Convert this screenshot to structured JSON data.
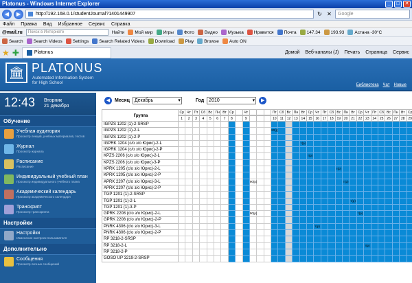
{
  "window": {
    "title": "Platonus - Windows Internet Explorer",
    "minimize": "_",
    "maximize": "□",
    "close": "✕"
  },
  "address": {
    "url": "http://192.168.0.1/studentJournal?1401449907",
    "search_placeholder": "Google",
    "back": "◀",
    "forward": "▶",
    "refresh": "↻",
    "stop": "✕"
  },
  "menu": [
    "Файл",
    "Правка",
    "Вид",
    "Избранное",
    "Сервис",
    "Справка"
  ],
  "toolbar": {
    "logo": "@mail.ru",
    "search_placeholder": "Поиск в Интернете",
    "find": "Найти",
    "items": [
      "Мой мир",
      "Игры",
      "Фото",
      "Видео",
      "Музыка",
      "Нравится",
      "Почта",
      "147.34",
      "193.93",
      "Астана -30°C"
    ]
  },
  "toolbar2": {
    "items": [
      "Search",
      "Search Videos",
      "Settings",
      "Search Related Videos",
      "Download",
      "Play",
      "Browse",
      "Auto ON"
    ]
  },
  "tabs": {
    "active": "Platonus",
    "tools": [
      "Домой",
      "Веб-каналы (J)",
      "Печать",
      "Страница",
      "Сервис"
    ]
  },
  "header": {
    "logo_glyph": "🏛",
    "brand": "PLATONUS",
    "sub1": "Automated Information System",
    "sub2": "for High School",
    "links": [
      "Библиотека",
      "Чат",
      "Новые"
    ]
  },
  "clock": {
    "time": "12:43",
    "day": "Вторник",
    "date": "21 декабря"
  },
  "sidebar": {
    "sections": [
      {
        "title": "Обучение",
        "items": [
          {
            "label": "Учебная аудитория",
            "sub": "Просмотр лекций, учебных материалов, тестов",
            "color": "#e8a040"
          },
          {
            "label": "Журнал",
            "sub": "Просмотр журнала",
            "color": "#6fb6e8"
          },
          {
            "label": "Расписание",
            "sub": "Расписание",
            "color": "#d8c060"
          },
          {
            "label": "Индивидуальный учебный план",
            "sub": "Просмотр индивидуального учебного плана",
            "color": "#80b860"
          },
          {
            "label": "Академический календарь",
            "sub": "Просмотр академического календаря",
            "color": "#c07060"
          },
          {
            "label": "Транскрипт",
            "sub": "Просмотр транскрипта",
            "color": "#a0a0d8"
          }
        ]
      },
      {
        "title": "Настройки",
        "items": [
          {
            "label": "Настройки",
            "sub": "Изменение настроек пользователя",
            "color": "#90a8c8"
          }
        ]
      },
      {
        "title": "Дополнительно",
        "items": [
          {
            "label": "Сообщения",
            "sub": "Просмотр личных сообщений",
            "color": "#e8c040"
          }
        ]
      }
    ]
  },
  "controls": {
    "prev": "◀",
    "next": "▶",
    "month_label": "Месяц",
    "month_value": "Декабрь",
    "year_label": "Год",
    "year_value": "2010"
  },
  "grid": {
    "group_header": "Группа",
    "weekday_row": [
      "Ср",
      "Чт",
      "Пт",
      "Сб",
      "Вс",
      "Пн",
      "Вт",
      "Ср",
      "",
      "Чт",
      "",
      "",
      "",
      "Пт",
      "Сб",
      "Вс",
      "Пн",
      "Вт",
      "Ср",
      "Чт",
      "Пт",
      "Сб",
      "Вс",
      "Пн",
      "Вт",
      "Ср",
      "Чт",
      "Пт",
      "Сб",
      "Вс",
      "Пн",
      "Вт",
      "Ср",
      "Чт",
      "Пт",
      "Сб"
    ],
    "day_row": [
      "1",
      "2",
      "3",
      "4",
      "5",
      "6",
      "7",
      "8",
      "",
      "9",
      "",
      "",
      "",
      "10",
      "11",
      "12",
      "13",
      "14",
      "15",
      "16",
      "17",
      "18",
      "19",
      "20",
      "21",
      "22",
      "23",
      "24",
      "25",
      "26",
      "27",
      "28",
      "29",
      "30",
      "31",
      ""
    ],
    "rows": [
      {
        "name": "IGPZS 1202 (1)-2-SRSP",
        "marks": {}
      },
      {
        "name": "IGPZS 1202 (1)-2-L",
        "marks": {
          "13": "90(р)"
        }
      },
      {
        "name": "IGPZS 1202 (1)-2-P",
        "marks": {}
      },
      {
        "name": "IGPRK 1204 (с/о з/о Юрис)-2-L",
        "marks": {
          "17": "т(р)"
        }
      },
      {
        "name": "IGPRK 1204 (с/о з/о Юрис)-2-P",
        "marks": {}
      },
      {
        "name": "KPZS 2206 (с/о з/о Юрис)-2-L",
        "marks": {
          "18": "т(р)"
        }
      },
      {
        "name": "KPZS 2206 (с/о з/о Юрис)-3-P",
        "marks": {}
      },
      {
        "name": "KPRK 1205 (с/о з/о Юрис)-2-L",
        "marks": {
          "22": "т(р)"
        }
      },
      {
        "name": "KPRK 1205 (с/о з/о Юрис)-2-P",
        "marks": {}
      },
      {
        "name": "APRK 2207 (с/о з/о Юрис)-3-L",
        "marks": {
          "10": "90(р)",
          "23": "т(р)"
        }
      },
      {
        "name": "APRK 2207 (с/о з/о Юрис)-2-P",
        "marks": {}
      },
      {
        "name": "TGP 1201 (1)-2-SRSP",
        "marks": {}
      },
      {
        "name": "TGP 1201 (1)-2-L",
        "marks": {
          "24": "т(р)"
        }
      },
      {
        "name": "TGP 1201 (1)-3-P",
        "marks": {}
      },
      {
        "name": "GPRK 2208 (с/о з/о Юрис)-2-L",
        "marks": {
          "10": "90(р)",
          "25": "т(р)"
        }
      },
      {
        "name": "GPRK 2208 (с/о з/о Юрис)-2-P",
        "marks": {}
      },
      {
        "name": "PNRK 4306 (с/о з/о Юрис)-3-L",
        "marks": {
          "19": "т(р)"
        }
      },
      {
        "name": "PNRK 4306 (с/о з/о Юрис)-2-P",
        "marks": {}
      },
      {
        "name": "RP 3218-2-SRSP",
        "marks": {}
      },
      {
        "name": "RP 3218-2-L",
        "marks": {
          "26": "т(р)"
        }
      },
      {
        "name": "RP 3218-2-P",
        "marks": {}
      },
      {
        "name": "GOSO UP 3219-2-SRSP",
        "marks": {}
      }
    ],
    "weekend_cols": [
      0,
      1,
      2,
      3,
      4,
      5,
      6,
      8,
      10,
      11,
      12
    ],
    "gray_cols": [
      15
    ]
  }
}
